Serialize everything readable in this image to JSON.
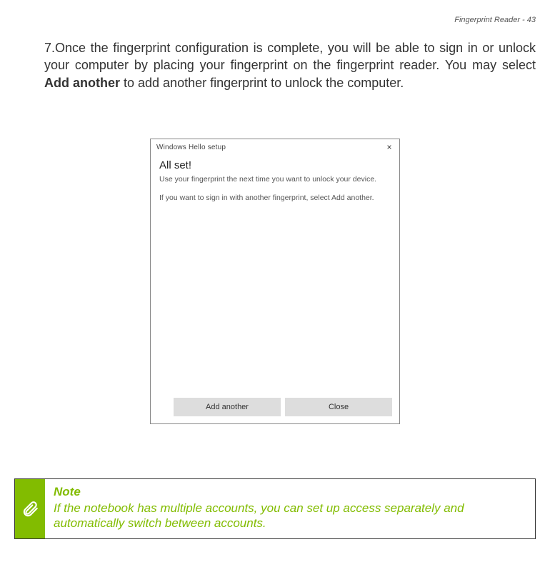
{
  "header": {
    "text": "Fingerprint Reader - 43"
  },
  "step": {
    "number": "7.",
    "part1": "Once the fingerprint configuration is complete, you will be able to sign in or unlock your computer by placing your fingerprint on the fingerprint reader. You may select ",
    "bold": "Add another",
    "part2": " to add another fingerprint to unlock the computer."
  },
  "dialog": {
    "title": "Windows Hello setup",
    "close": "×",
    "heading": "All set!",
    "p1": "Use your fingerprint the next time you want to unlock your device.",
    "p2": "If you want to sign in with another fingerprint, select Add another.",
    "btn_add": "Add another",
    "btn_close": "Close"
  },
  "note": {
    "title": "Note",
    "body": "If the notebook has multiple accounts, you can set up access separately and automatically switch between accounts."
  }
}
